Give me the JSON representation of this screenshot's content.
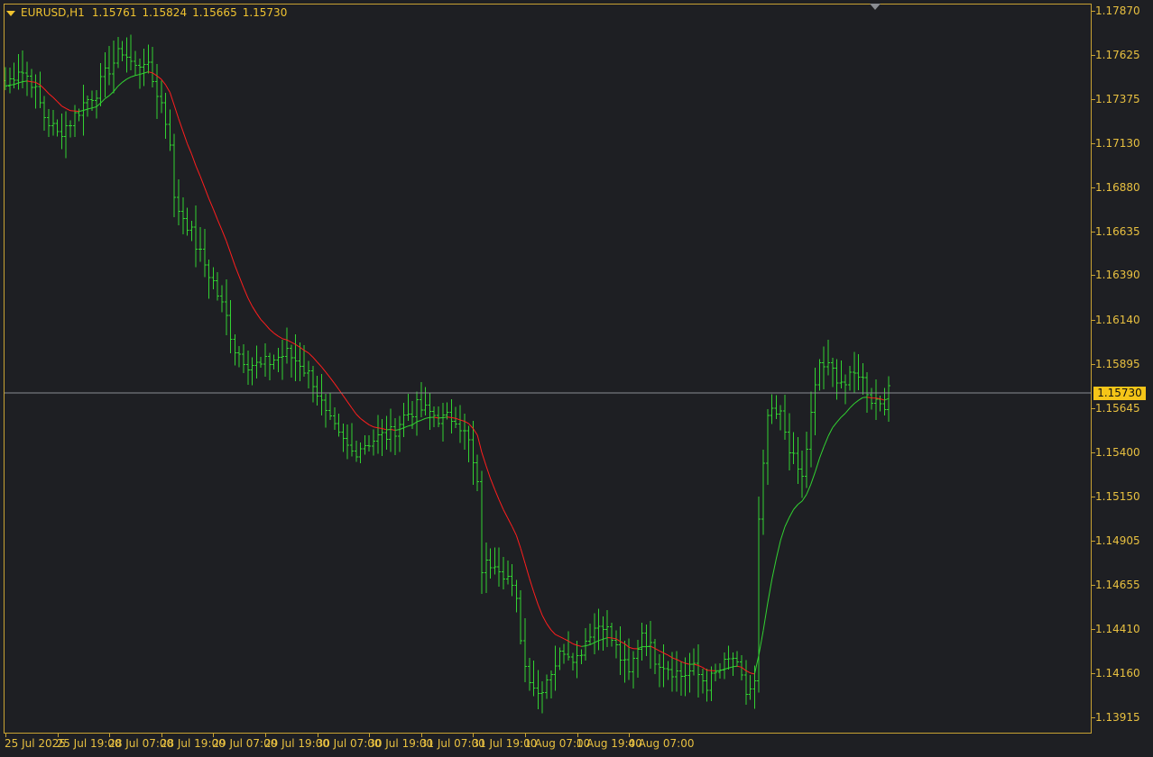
{
  "window": {
    "symbol": "EURUSD,H1",
    "ohlc": [
      "1.15761",
      "1.15824",
      "1.15665",
      "1.15730"
    ]
  },
  "colors": {
    "background": "#1e1f23",
    "frame": "#c8a233",
    "labels": "#e8c040",
    "bars": "#32d232",
    "ma_up": "#32d232",
    "ma_down": "#ff1e1e",
    "bid_line": "#8a8d93",
    "price_badge": "#f5c518"
  },
  "current_price": "1.15730",
  "chart_data": {
    "type": "ohlc",
    "timeframe": "H1",
    "ylim": [
      1.13915,
      1.1787
    ],
    "price_ticks": [
      "1.17870",
      "1.17625",
      "1.17375",
      "1.17130",
      "1.16880",
      "1.16635",
      "1.16390",
      "1.16140",
      "1.15895",
      "1.15645",
      "1.15400",
      "1.15150",
      "1.14905",
      "1.14655",
      "1.14410",
      "1.14160",
      "1.13915"
    ],
    "time_ticks": [
      "25 Jul 2025",
      "25 Jul 19:00",
      "28 Jul 07:00",
      "28 Jul 19:00",
      "29 Jul 07:00",
      "29 Jul 19:00",
      "30 Jul 07:00",
      "30 Jul 19:00",
      "31 Jul 07:00",
      "31 Jul 19:00",
      "1 Aug 07:00",
      "1 Aug 19:00",
      "4 Aug 07:00"
    ],
    "bar_step_hours": 1,
    "close_anchors": [
      [
        0,
        1.1745
      ],
      [
        3,
        1.1755
      ],
      [
        6,
        1.1748
      ],
      [
        9,
        1.1728
      ],
      [
        12,
        1.1718
      ],
      [
        15,
        1.1725
      ],
      [
        18,
        1.1735
      ],
      [
        21,
        1.1742
      ],
      [
        24,
        1.1755
      ],
      [
        27,
        1.1765
      ],
      [
        30,
        1.1755
      ],
      [
        32,
        1.176
      ],
      [
        34,
        1.1748
      ],
      [
        36,
        1.1735
      ],
      [
        38,
        1.1715
      ],
      [
        39,
        1.168
      ],
      [
        42,
        1.1668
      ],
      [
        45,
        1.165
      ],
      [
        48,
        1.1635
      ],
      [
        51,
        1.1615
      ],
      [
        53,
        1.1598
      ],
      [
        56,
        1.159
      ],
      [
        59,
        1.1588
      ],
      [
        62,
        1.1592
      ],
      [
        65,
        1.1595
      ],
      [
        68,
        1.159
      ],
      [
        71,
        1.158
      ],
      [
        74,
        1.156
      ],
      [
        77,
        1.1548
      ],
      [
        80,
        1.154
      ],
      [
        83,
        1.1545
      ],
      [
        86,
        1.1548
      ],
      [
        89,
        1.155
      ],
      [
        92,
        1.156
      ],
      [
        95,
        1.1565
      ],
      [
        98,
        1.1562
      ],
      [
        101,
        1.1558
      ],
      [
        104,
        1.156
      ],
      [
        107,
        1.1545
      ],
      [
        109,
        1.152
      ],
      [
        110,
        1.1475
      ],
      [
        113,
        1.148
      ],
      [
        116,
        1.147
      ],
      [
        118,
        1.1455
      ],
      [
        120,
        1.142
      ],
      [
        123,
        1.1405
      ],
      [
        126,
        1.1418
      ],
      [
        129,
        1.143
      ],
      [
        132,
        1.1425
      ],
      [
        135,
        1.144
      ],
      [
        138,
        1.1445
      ],
      [
        141,
        1.143
      ],
      [
        144,
        1.1415
      ],
      [
        147,
        1.144
      ],
      [
        150,
        1.1425
      ],
      [
        153,
        1.142
      ],
      [
        156,
        1.1415
      ],
      [
        159,
        1.1418
      ],
      [
        162,
        1.141
      ],
      [
        165,
        1.1418
      ],
      [
        168,
        1.1425
      ],
      [
        171,
        1.1405
      ],
      [
        173,
        1.141
      ],
      [
        174,
        1.15
      ],
      [
        176,
        1.156
      ],
      [
        179,
        1.156
      ],
      [
        182,
        1.1535
      ],
      [
        184,
        1.1525
      ],
      [
        186,
        1.156
      ],
      [
        188,
        1.159
      ],
      [
        191,
        1.1585
      ],
      [
        194,
        1.1578
      ],
      [
        197,
        1.1585
      ],
      [
        200,
        1.157
      ],
      [
        203,
        1.1568
      ],
      [
        204,
        1.1573
      ]
    ],
    "moving_average": {
      "type": "smoothed",
      "period": 8,
      "coloring": "green when rising, red when falling"
    }
  }
}
